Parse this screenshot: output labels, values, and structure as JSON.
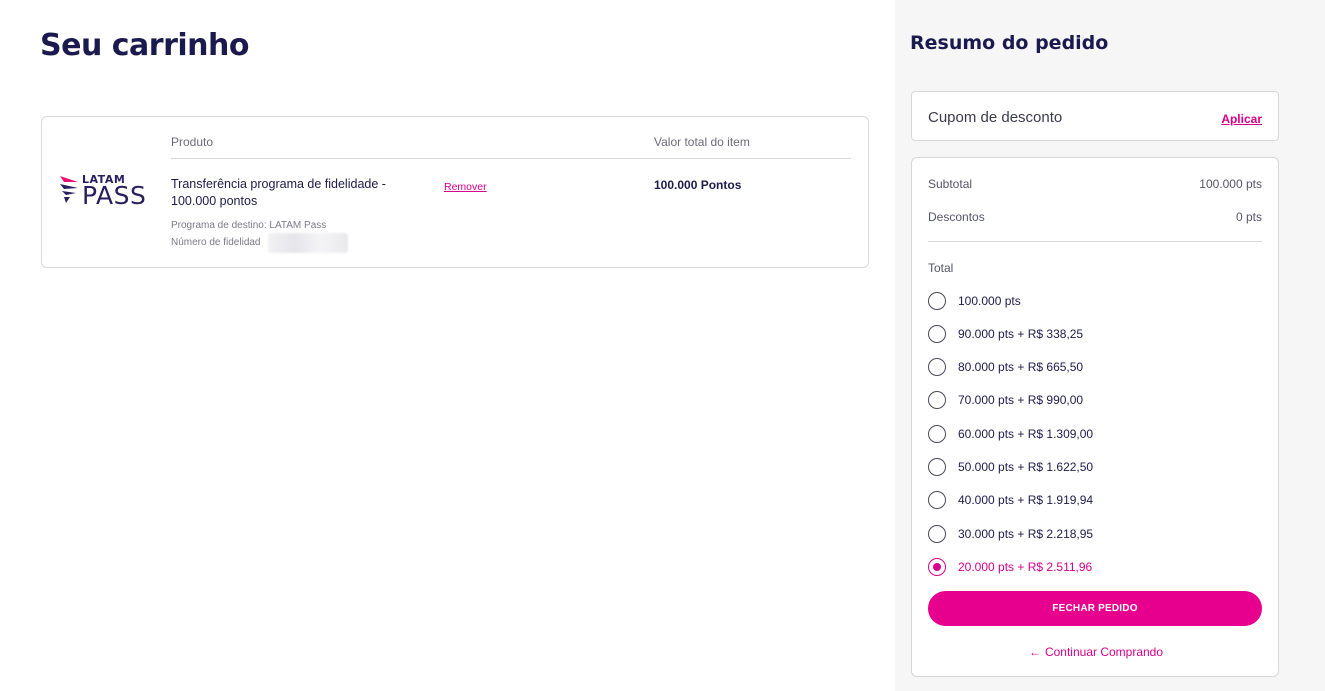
{
  "cart": {
    "title": "Seu carrinho",
    "columns": {
      "product": "Produto",
      "item_total": "Valor total do item"
    },
    "item": {
      "brand_top": "LATAM",
      "brand_bottom": "PASS",
      "name": "Transferência programa de fidelidade - 100.000 pontos",
      "remove_label": "Remover",
      "value": "100.000 Pontos",
      "destination": "Programa de destino: LATAM Pass",
      "loyalty_number_label": "Número de fidelidad"
    }
  },
  "summary": {
    "title": "Resumo do pedido",
    "coupon": {
      "label": "Cupom de desconto",
      "apply_label": "Aplicar"
    },
    "subtotal_label": "Subtotal",
    "subtotal_value": "100.000 pts",
    "discounts_label": "Descontos",
    "discounts_value": "0 pts",
    "total_label": "Total",
    "options": [
      {
        "label": "100.000 pts",
        "selected": false
      },
      {
        "label": "90.000 pts + R$ 338,25",
        "selected": false
      },
      {
        "label": "80.000 pts + R$ 665,50",
        "selected": false
      },
      {
        "label": "70.000 pts + R$ 990,00",
        "selected": false
      },
      {
        "label": "60.000 pts + R$ 1.309,00",
        "selected": false
      },
      {
        "label": "50.000 pts + R$ 1.622,50",
        "selected": false
      },
      {
        "label": "40.000 pts + R$ 1.919,94",
        "selected": false
      },
      {
        "label": "30.000 pts + R$ 2.218,95",
        "selected": false
      },
      {
        "label": "20.000 pts + R$ 2.511,96",
        "selected": true
      }
    ],
    "checkout_label": "FECHAR PEDIDO",
    "continue_label": "Continuar Comprando",
    "continue_icon": "arrow-left-icon"
  },
  "colors": {
    "accent": "#e6008d",
    "heading": "#1b1a4e",
    "panel_bg": "#f6f6f6"
  }
}
